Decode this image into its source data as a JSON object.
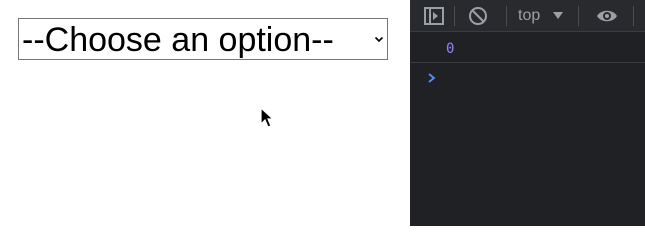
{
  "page": {
    "select": {
      "value": "--Choose an option--"
    }
  },
  "devtools": {
    "context": "top",
    "icons": [
      "sidebar-toggle-icon",
      "clear-console-icon",
      "dropdown-arrow-icon",
      "eye-icon"
    ],
    "console": {
      "output_value": "0",
      "prompt_icon": "prompt-chevron-icon"
    }
  },
  "colors": {
    "devtools_bg": "#202124",
    "toolbar_bg": "#292a2d",
    "number_color": "#9980ff",
    "prompt_color": "#4d90fe"
  }
}
